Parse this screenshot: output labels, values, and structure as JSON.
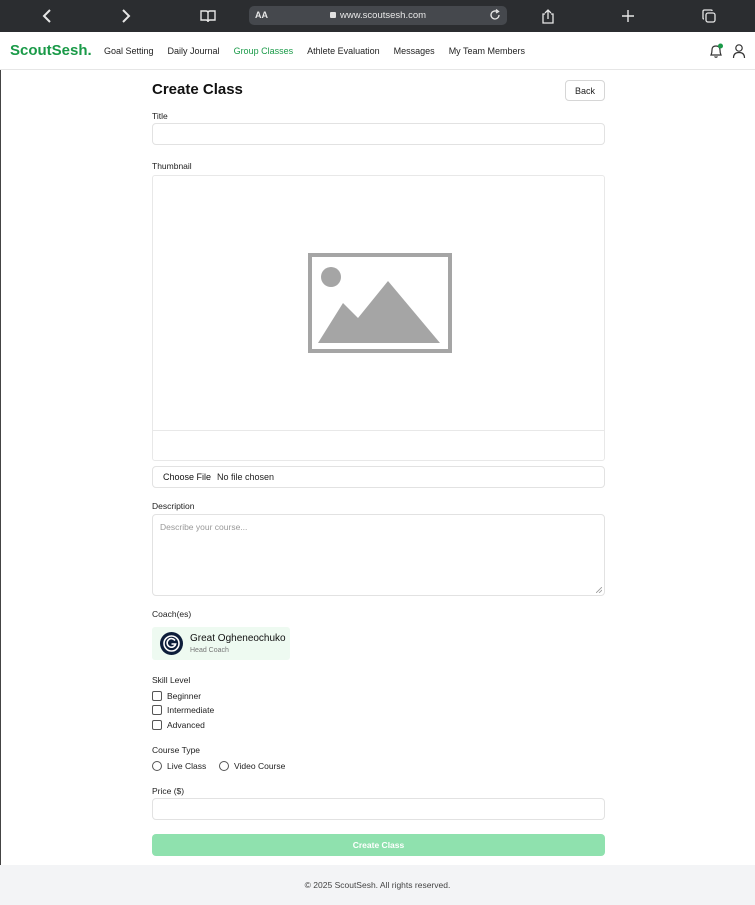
{
  "browser": {
    "url": "www.scoutsesh.com",
    "aa_label": "AA"
  },
  "nav": {
    "brand": "ScoutSesh.",
    "links": [
      {
        "label": "Goal Setting",
        "active": false
      },
      {
        "label": "Daily Journal",
        "active": false
      },
      {
        "label": "Group Classes",
        "active": true
      },
      {
        "label": "Athlete Evaluation",
        "active": false
      },
      {
        "label": "Messages",
        "active": false
      },
      {
        "label": "My Team Members",
        "active": false
      }
    ]
  },
  "form": {
    "page_title": "Create Class",
    "back_label": "Back",
    "title_label": "Title",
    "title_value": "",
    "thumbnail_label": "Thumbnail",
    "choose_file_label": "Choose File",
    "file_status": "No file chosen",
    "description_label": "Description",
    "description_placeholder": "Describe your course...",
    "coaches_label": "Coach(es)",
    "coach": {
      "name": "Great Ogheneochuko",
      "role": "Head Coach"
    },
    "skill_level_label": "Skill Level",
    "skill_levels": [
      "Beginner",
      "Intermediate",
      "Advanced"
    ],
    "course_type_label": "Course Type",
    "course_types": [
      "Live Class",
      "Video Course"
    ],
    "price_label": "Price ($)",
    "price_value": "",
    "submit_label": "Create Class"
  },
  "footer": {
    "text": "© 2025 ScoutSesh. All rights reserved."
  },
  "colors": {
    "brand": "#1a9a48",
    "submit_disabled": "#8fe1ae",
    "browser_chrome": "#2b2d30"
  }
}
